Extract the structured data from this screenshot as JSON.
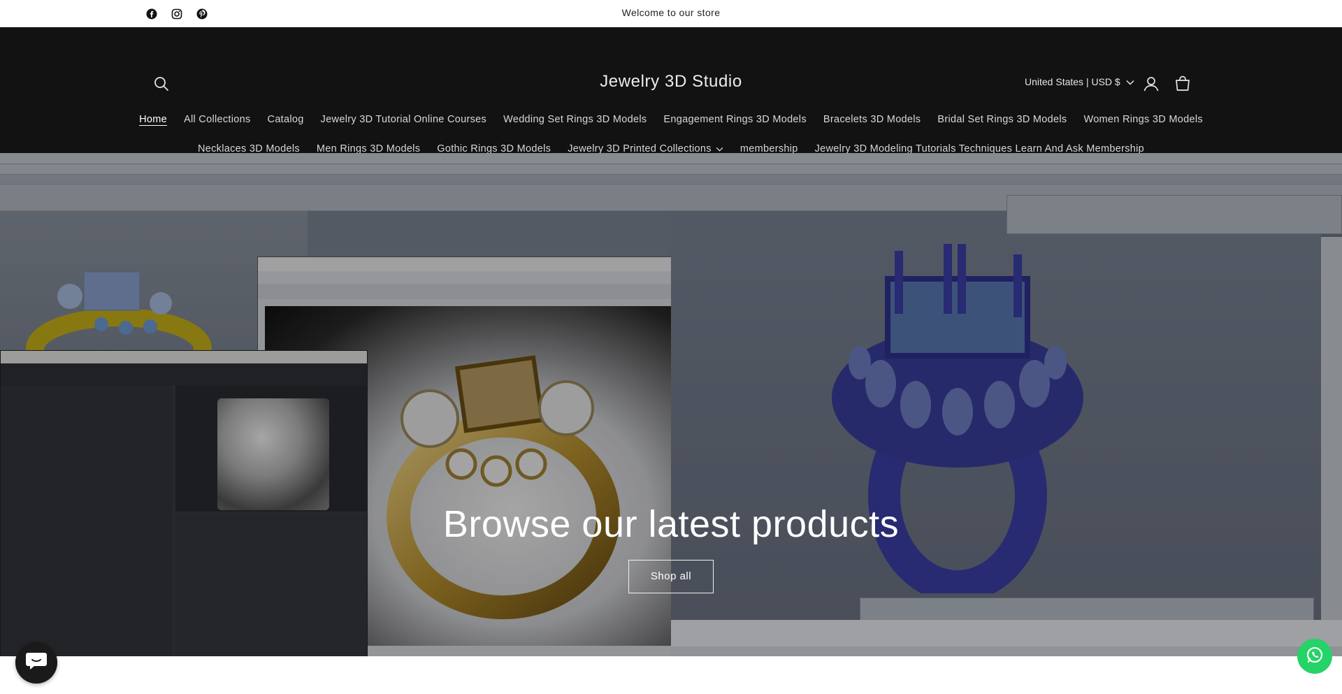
{
  "announcement": {
    "text": "Welcome to our store",
    "social": [
      "facebook-icon",
      "instagram-icon",
      "pinterest-icon"
    ]
  },
  "header": {
    "store_name": "Jewelry 3D Studio",
    "country_selector": "United States | USD $",
    "icons": [
      "search-icon",
      "account-icon",
      "cart-icon"
    ]
  },
  "nav": {
    "row1": [
      {
        "label": "Home"
      },
      {
        "label": "All Collections"
      },
      {
        "label": "Catalog"
      },
      {
        "label": "Jewelry 3D Tutorial Online Courses"
      },
      {
        "label": "Wedding Set Rings 3D Models"
      },
      {
        "label": "Engagement Rings 3D Models"
      },
      {
        "label": "Bracelets 3D Models"
      },
      {
        "label": "Bridal Set Rings 3D Models"
      },
      {
        "label": "Women Rings 3D Models"
      }
    ],
    "row2": [
      {
        "label": "Necklaces 3D Models"
      },
      {
        "label": "Men Rings 3D Models"
      },
      {
        "label": "Gothic Rings 3D Models"
      },
      {
        "label": "Jewelry 3D Printed Collections"
      },
      {
        "label": "membership"
      },
      {
        "label": "Jewelry 3D Modeling Tutorials Techniques Learn And Ask Membership"
      }
    ]
  },
  "hero": {
    "title": "Browse our latest products",
    "button": "Shop all"
  },
  "colors": {
    "header_bg": "#121212",
    "whatsapp": "#25d366",
    "chat": "#1a1a1a"
  }
}
